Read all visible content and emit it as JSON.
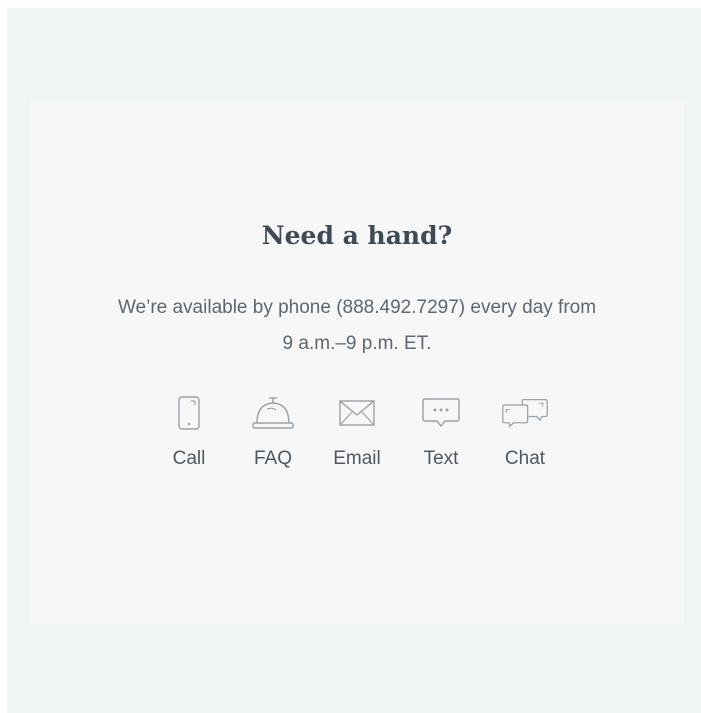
{
  "help": {
    "title": "Need a hand?",
    "description_line1": "We’re available by phone (888.492.7297) every day from",
    "description_line2": "9 a.m.–9 p.m. ET.",
    "channels": [
      {
        "label": "Call",
        "icon": "phone-icon"
      },
      {
        "label": "FAQ",
        "icon": "service-bell-icon"
      },
      {
        "label": "Email",
        "icon": "envelope-icon"
      },
      {
        "label": "Text",
        "icon": "text-bubble-icon"
      },
      {
        "label": "Chat",
        "icon": "chat-bubbles-icon"
      }
    ]
  },
  "colors": {
    "outer_background": "#eef5f4",
    "card_background": "#f7f7f7",
    "title": "#3f4a57",
    "body_text": "#5d6771",
    "icon_stroke": "#9aa1a8"
  }
}
